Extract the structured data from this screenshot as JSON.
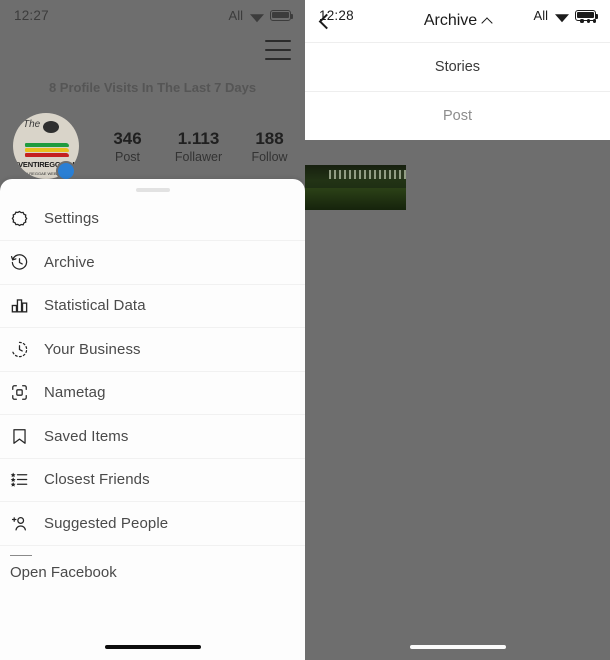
{
  "left_screen": {
    "status_bar": {
      "time": "12:27",
      "carrier": "All",
      "wifi_icon": "wifi-icon",
      "battery_icon": "battery-icon"
    },
    "profile": {
      "menu_icon": "hamburger-menu-icon",
      "visits_text": "8 Profile Visits In The Last 7 Days",
      "avatar_logo_top": "The",
      "avatar_logo_brand": "EVENTIREGGAE.IT",
      "avatar_logo_sub": "ITALIAN REGGAE WEB MAGAZINE",
      "stats": [
        {
          "value": "346",
          "label": "Post"
        },
        {
          "value": "1.113",
          "label": "Follawer"
        },
        {
          "value": "188",
          "label": "Follow"
        }
      ]
    },
    "sheet": {
      "handle": "drag-handle",
      "items": [
        {
          "label": "Settings",
          "icon": "gear-icon"
        },
        {
          "label": "Archive",
          "icon": "clock-history-icon"
        },
        {
          "label": "Statistical Data",
          "icon": "bar-chart-icon"
        },
        {
          "label": "Your Business",
          "icon": "clock-dashed-icon"
        },
        {
          "label": "Nametag",
          "icon": "nametag-icon"
        },
        {
          "label": "Saved Items",
          "icon": "bookmark-icon"
        },
        {
          "label": "Closest Friends",
          "icon": "star-list-icon"
        },
        {
          "label": "Suggested People",
          "icon": "person-add-icon"
        }
      ],
      "footer_label": "Open Facebook"
    },
    "home_indicator": "home-indicator"
  },
  "right_screen": {
    "status_bar": {
      "time": "12:28",
      "carrier": "All",
      "wifi_icon": "wifi-icon",
      "battery_icon": "battery-icon"
    },
    "navbar": {
      "back_icon": "back-chevron-icon",
      "title": "Archive",
      "title_chevron": "chevron-up-icon",
      "more_icon": "more-options-icon"
    },
    "dropdown": {
      "options": [
        {
          "label": "Stories",
          "selected": true
        },
        {
          "label": "Post",
          "selected": false
        }
      ]
    },
    "thumbnail": "archived-story-thumbnail",
    "home_indicator": "home-indicator"
  }
}
